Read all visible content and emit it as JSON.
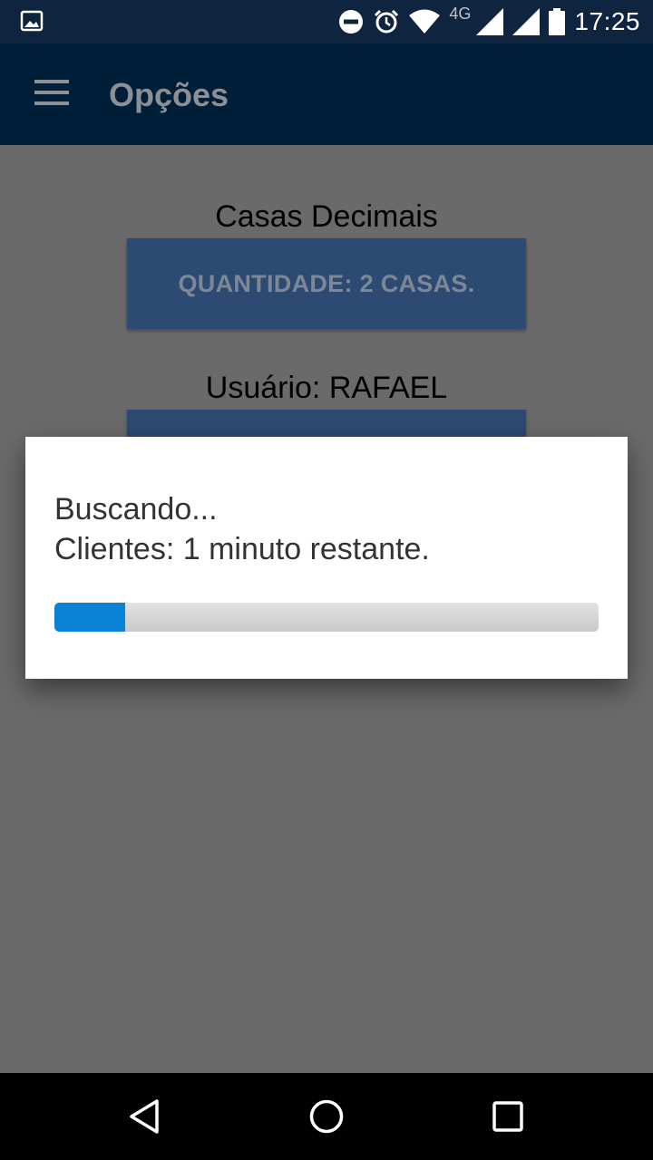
{
  "status_bar": {
    "time": "17:25",
    "network": "4G",
    "icons": [
      "image-notification-icon",
      "do-not-disturb-icon",
      "alarm-icon",
      "wifi-icon",
      "signal-icon",
      "signal-icon-2",
      "battery-icon"
    ]
  },
  "app_bar": {
    "title": "Opções",
    "menu_icon": "hamburger-menu-icon"
  },
  "options": {
    "decimal_label": "Casas Decimais",
    "decimal_button": "QUANTIDADE: 2 CASAS.",
    "user_label": "Usuário: RAFAEL"
  },
  "dialog": {
    "line1": "Buscando...",
    "line2": "Clientes: 1 minuto restante.",
    "progress_percent": 13
  },
  "nav_bar": {
    "icons": [
      "back-icon",
      "home-icon",
      "recents-icon"
    ]
  },
  "colors": {
    "app_bar": "#023866",
    "button": "#2d4a73",
    "progress": "#0a83d6"
  }
}
